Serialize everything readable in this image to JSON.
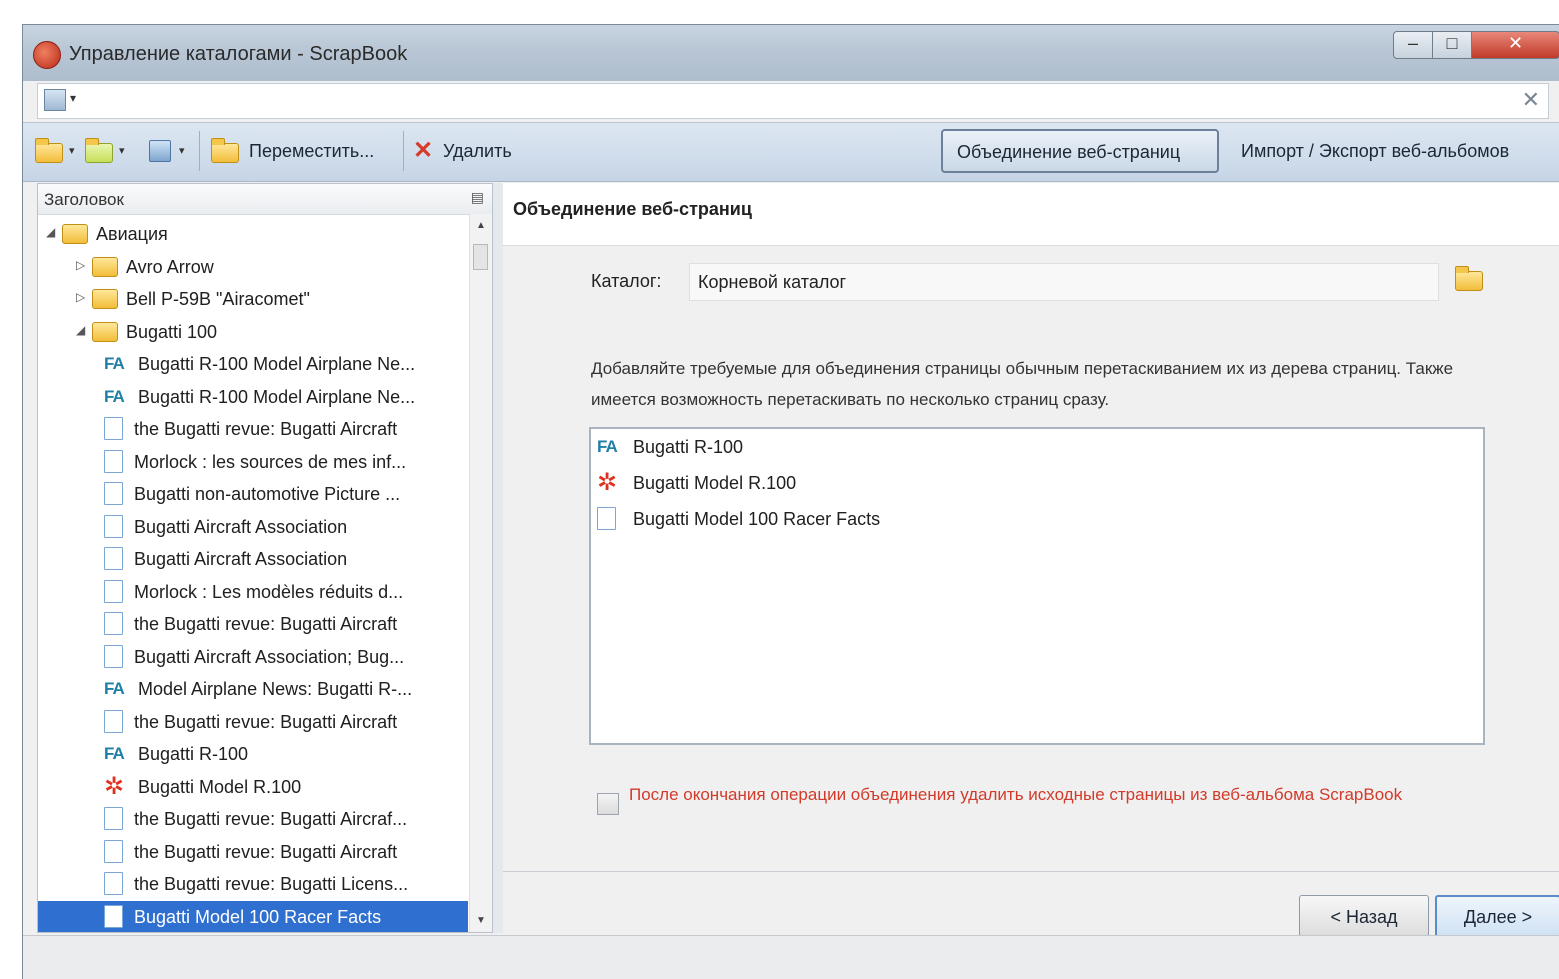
{
  "window": {
    "title": "Управление каталогами - ScrapBook",
    "minimize_glyph": "–",
    "maximize_glyph": "□",
    "close_glyph": "✕"
  },
  "search": {
    "value": "",
    "placeholder": "",
    "clear_glyph": "✕"
  },
  "toolbar": {
    "move_label": "Переместить...",
    "delete_label": "Удалить",
    "tab_merge_label": "Объединение веб-страниц",
    "tab_import_export_label": "Импорт / Экспорт веб-альбомов"
  },
  "tree": {
    "header_label": "Заголовок",
    "rows": [
      {
        "label": "Авиация",
        "type": "folder",
        "level": 0,
        "twisty": "◢"
      },
      {
        "label": "Avro Arrow",
        "type": "folder",
        "level": 1,
        "twisty": "▷"
      },
      {
        "label": "Bell  P-59B  \"Airacomet\"",
        "type": "folder",
        "level": 1,
        "twisty": "▷"
      },
      {
        "label": "Bugatti 100",
        "type": "folder",
        "level": 1,
        "twisty": "◢"
      },
      {
        "label": "Bugatti R-100 Model Airplane Ne...",
        "type": "fa",
        "level": 2
      },
      {
        "label": "Bugatti R-100 Model Airplane Ne...",
        "type": "fa",
        "level": 2
      },
      {
        "label": "the Bugatti revue: Bugatti Aircraft",
        "type": "page",
        "level": 2
      },
      {
        "label": "Morlock : les sources de mes inf...",
        "type": "page",
        "level": 2
      },
      {
        "label": "Bugatti non-automotive Picture ...",
        "type": "page",
        "level": 2
      },
      {
        "label": "Bugatti Aircraft Association",
        "type": "page",
        "level": 2
      },
      {
        "label": "Bugatti Aircraft Association",
        "type": "page",
        "level": 2
      },
      {
        "label": "Morlock : Les modèles réduits d...",
        "type": "page",
        "level": 2
      },
      {
        "label": "the Bugatti revue: Bugatti Aircraft",
        "type": "page",
        "level": 2
      },
      {
        "label": "Bugatti Aircraft Association; Bug...",
        "type": "page",
        "level": 2
      },
      {
        "label": "Model Airplane News: Bugatti R-...",
        "type": "fa",
        "level": 2
      },
      {
        "label": "the Bugatti revue: Bugatti Aircraft",
        "type": "page",
        "level": 2
      },
      {
        "label": "Bugatti R-100",
        "type": "fa",
        "level": 2
      },
      {
        "label": "Bugatti Model R.100",
        "type": "star",
        "level": 2
      },
      {
        "label": "the Bugatti revue: Bugatti Aircraf...",
        "type": "page",
        "level": 2
      },
      {
        "label": "the Bugatti revue: Bugatti Aircraft",
        "type": "page",
        "level": 2
      },
      {
        "label": "the Bugatti revue: Bugatti Licens...",
        "type": "page",
        "level": 2
      },
      {
        "label": "Bugatti Model 100 Racer Facts",
        "type": "page",
        "level": 2,
        "selected": true
      }
    ]
  },
  "wizard": {
    "title": "Объединение веб-страниц",
    "catalog_label": "Каталог:",
    "catalog_value": "Корневой каталог",
    "instruction": "Добавляйте требуемые для объединения страницы обычным перетаскиванием их из дерева страниц. Также имеется возможность перетаскивать по несколько страниц сразу.",
    "list": [
      {
        "label": "Bugatti R-100",
        "type": "fa"
      },
      {
        "label": "Bugatti Model R.100",
        "type": "star"
      },
      {
        "label": "Bugatti Model 100 Racer Facts",
        "type": "page"
      }
    ],
    "delete_after_label": "После окончания операции объединения удалить исходные страницы из веб-альбома ScrapBook",
    "delete_after_checked": false,
    "back_label": "< Назад",
    "next_label": "Далее >"
  },
  "icons": {
    "fa_text": "FA",
    "star_glyph": "✲"
  },
  "colors": {
    "selection": "#2f6fd0",
    "warning_text": "#d23a2a",
    "title_bar": "#b8c6d5"
  }
}
